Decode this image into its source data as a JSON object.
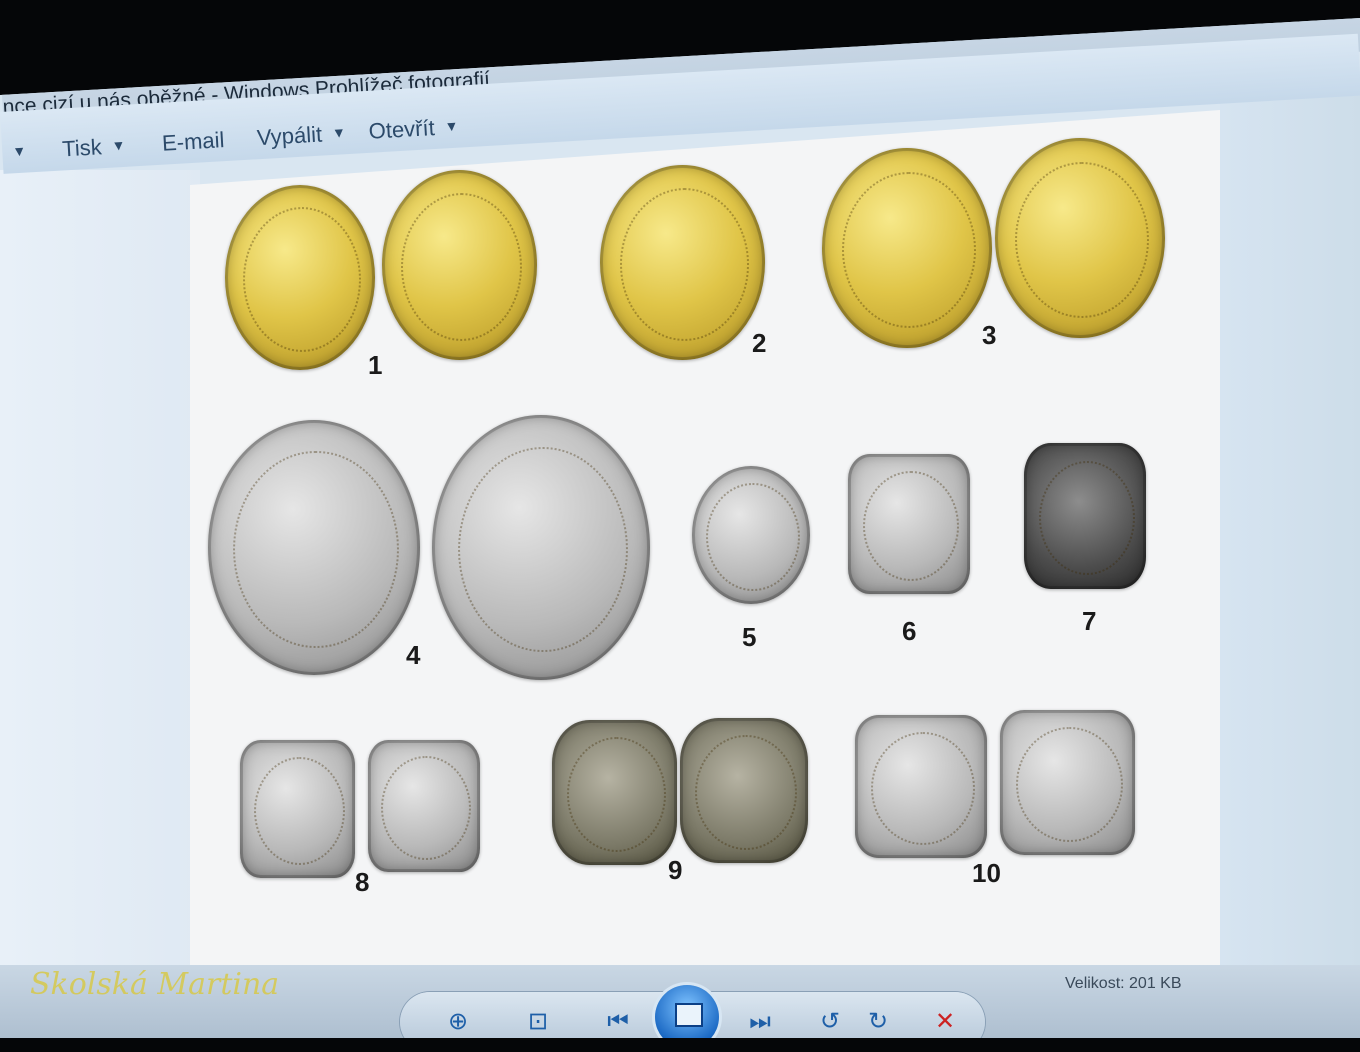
{
  "window": {
    "title": "nce cizí u nás oběžné - Windows Prohlížeč fotografií"
  },
  "menu": {
    "items": [
      {
        "label": "Tisk"
      },
      {
        "label": "E-mail"
      },
      {
        "label": "Vypálit"
      },
      {
        "label": "Otevřít"
      }
    ]
  },
  "photo": {
    "coin_labels": [
      "1",
      "2",
      "3",
      "4",
      "5",
      "6",
      "7",
      "8",
      "9",
      "10"
    ]
  },
  "status": {
    "size_text": "Velikost: 201 KB"
  },
  "watermark": {
    "text": "Skolská Martina"
  },
  "colors": {
    "accent": "#1b69c4",
    "close": "#cc2222"
  },
  "toolbar_icons": [
    "zoom-icon",
    "actual-size-icon",
    "previous-icon",
    "slideshow-icon",
    "next-icon",
    "rotate-left-icon",
    "rotate-right-icon",
    "delete-icon"
  ]
}
